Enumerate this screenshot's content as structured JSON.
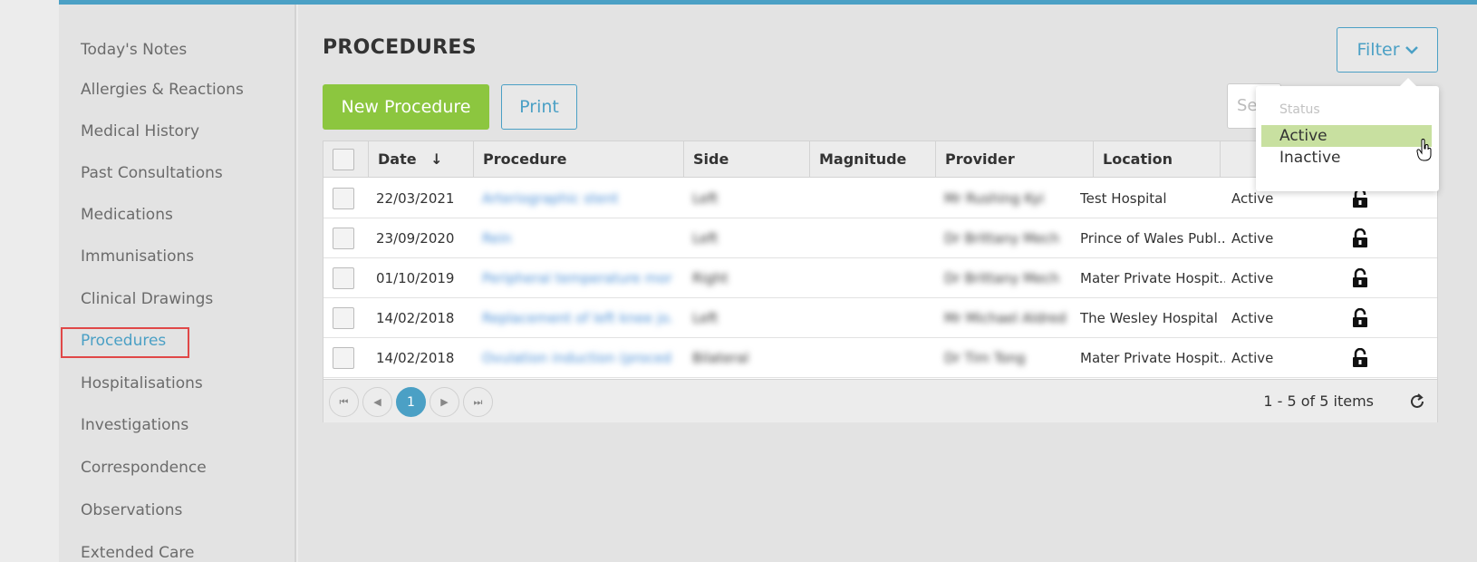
{
  "sidebar": {
    "items": [
      {
        "label": "Today's Notes"
      },
      {
        "label": "Allergies & Reactions"
      },
      {
        "label": "Medical History"
      },
      {
        "label": "Past Consultations"
      },
      {
        "label": "Medications"
      },
      {
        "label": "Immunisations"
      },
      {
        "label": "Clinical Drawings"
      },
      {
        "label": "Procedures",
        "active": true
      },
      {
        "label": "Hospitalisations"
      },
      {
        "label": "Investigations"
      },
      {
        "label": "Correspondence"
      },
      {
        "label": "Observations"
      },
      {
        "label": "Extended Care"
      }
    ]
  },
  "page": {
    "title": "PROCEDURES",
    "new_button": "New Procedure",
    "print_button": "Print",
    "filter_button": "Filter",
    "search_placeholder": "Se"
  },
  "table": {
    "columns": [
      "Date",
      "Procedure",
      "Side",
      "Magnitude",
      "Provider",
      "Location"
    ],
    "sort_indicator": "↓",
    "rows": [
      {
        "date": "22/03/2021",
        "procedure": "Arteriographic stent",
        "side": "Left",
        "magnitude": "",
        "provider": "Mr Rushing Kyi",
        "location": "Test Hospital",
        "status": "Active"
      },
      {
        "date": "23/09/2020",
        "procedure": "Rein",
        "side": "Left",
        "magnitude": "",
        "provider": "Dr Brittany Mech",
        "location": "Prince of Wales Publ...",
        "status": "Active"
      },
      {
        "date": "01/10/2019",
        "procedure": "Peripheral temperature mon...",
        "side": "Right",
        "magnitude": "",
        "provider": "Dr Brittany Mech",
        "location": "Mater Private Hospit...",
        "status": "Active"
      },
      {
        "date": "14/02/2018",
        "procedure": "Replacement of left knee jo...",
        "side": "Left",
        "magnitude": "",
        "provider": "Mr Michael Aldred",
        "location": "The Wesley Hospital",
        "status": "Active"
      },
      {
        "date": "14/02/2018",
        "procedure": "Ovulation induction (proced...",
        "side": "Bilateral",
        "magnitude": "",
        "provider": "Dr Tim Tong",
        "location": "Mater Private Hospit...",
        "status": "Active"
      }
    ]
  },
  "pager": {
    "current_page": "1",
    "items_info": "1 - 5 of 5 items"
  },
  "filter_dropdown": {
    "label": "Status",
    "options": [
      "Active",
      "Inactive"
    ],
    "selected": "Active"
  },
  "colors": {
    "accent": "#4ba0c5",
    "new_button": "#8cc63f",
    "selected_option": "#c8e0a0",
    "highlight_box": "#e04848"
  }
}
